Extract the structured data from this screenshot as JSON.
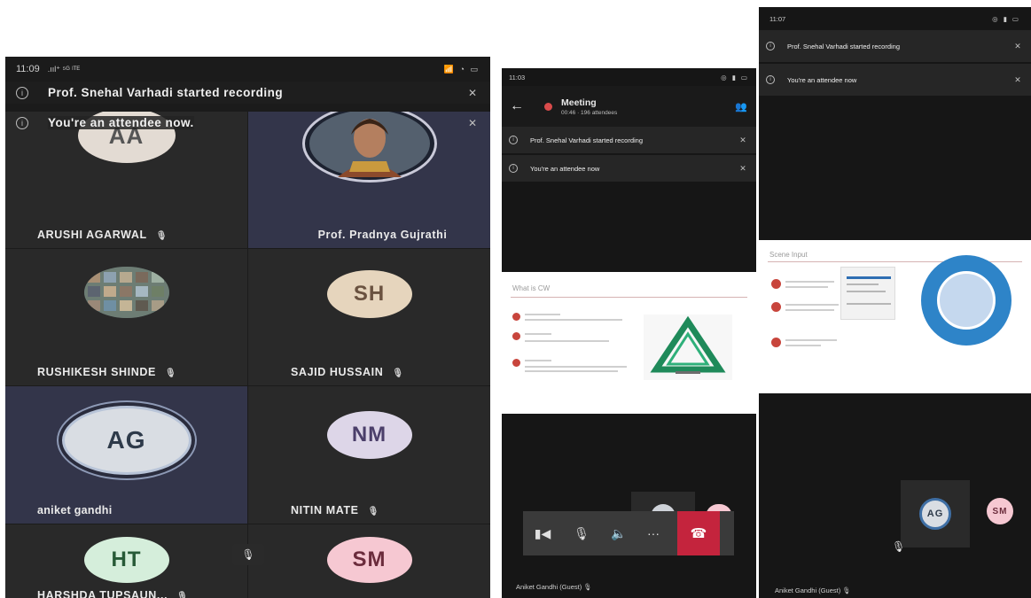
{
  "screen1": {
    "status": {
      "time": "11:09",
      "signal": ".ııl⁺ ⁵ᴳ ˡᵀᴱ",
      "right": "📶 ◔ ▭"
    },
    "banners": [
      {
        "text": "Prof. Snehal Varhadi started recording",
        "close": "✕"
      },
      {
        "text": "You're an attendee now.",
        "close": "✕"
      }
    ],
    "participants": [
      {
        "initials": "AA",
        "name": "ARUSHI AGARWAL",
        "muted": "🎙"
      },
      {
        "initials": "",
        "name": "Prof. Pradnya Gujrathi",
        "muted": ""
      },
      {
        "initials": "",
        "name": "RUSHIKESH SHINDE",
        "muted": "🎙"
      },
      {
        "initials": "SH",
        "name": "SAJID HUSSAIN",
        "muted": "🎙"
      },
      {
        "initials": "AG",
        "name": "aniket gandhi",
        "muted": ""
      },
      {
        "initials": "NM",
        "name": "NITIN MATE",
        "muted": "🎙"
      },
      {
        "initials": "HT",
        "name": "HARSHDA TUPSAUN...",
        "muted": "🎙"
      },
      {
        "initials": "SM",
        "name": "",
        "muted": ""
      }
    ],
    "mic_icon": "🎙"
  },
  "screen2": {
    "status": {
      "time": "11:03",
      "right": "◎ ▮ ▭"
    },
    "header": {
      "back": "←",
      "title": "Meeting",
      "subtitle": "00:46 · 196 attendees",
      "people": "👥"
    },
    "banners": [
      {
        "text": "Prof. Snehal Varhadi started recording",
        "close": "✕"
      },
      {
        "text": "You're an attendee now",
        "close": "✕"
      }
    ],
    "slide": {
      "title": "What is CW"
    },
    "controls": {
      "video": "▮◀",
      "mic": "🎙",
      "speaker": "🔈",
      "more": "···",
      "hangup": "☎"
    },
    "bottom_name": "Aniket Gandhi (Guest)  🎙"
  },
  "screen3": {
    "status": {
      "time": "11:07",
      "right": "◎ ▮ ▭"
    },
    "banners": [
      {
        "text": "Prof. Snehal Varhadi started recording",
        "close": "✕"
      },
      {
        "text": "You're an attendee now",
        "close": "✕"
      }
    ],
    "slide": {
      "title": "Scene Input"
    },
    "self_initials": "AG",
    "other_initials": "SM",
    "mic_icon": "🎙",
    "bottom_name": "Aniket Gandhi (Guest)  🎙"
  },
  "colors": {
    "aa": "#e3dbd3",
    "sh": "#e6d5bd",
    "ag": "#d9dde3",
    "nm": "#ddd6e8",
    "ht": "#d5eedb",
    "sm": "#f6c8d2",
    "ring": "#2e84c8",
    "hangup": "#c4243d"
  }
}
